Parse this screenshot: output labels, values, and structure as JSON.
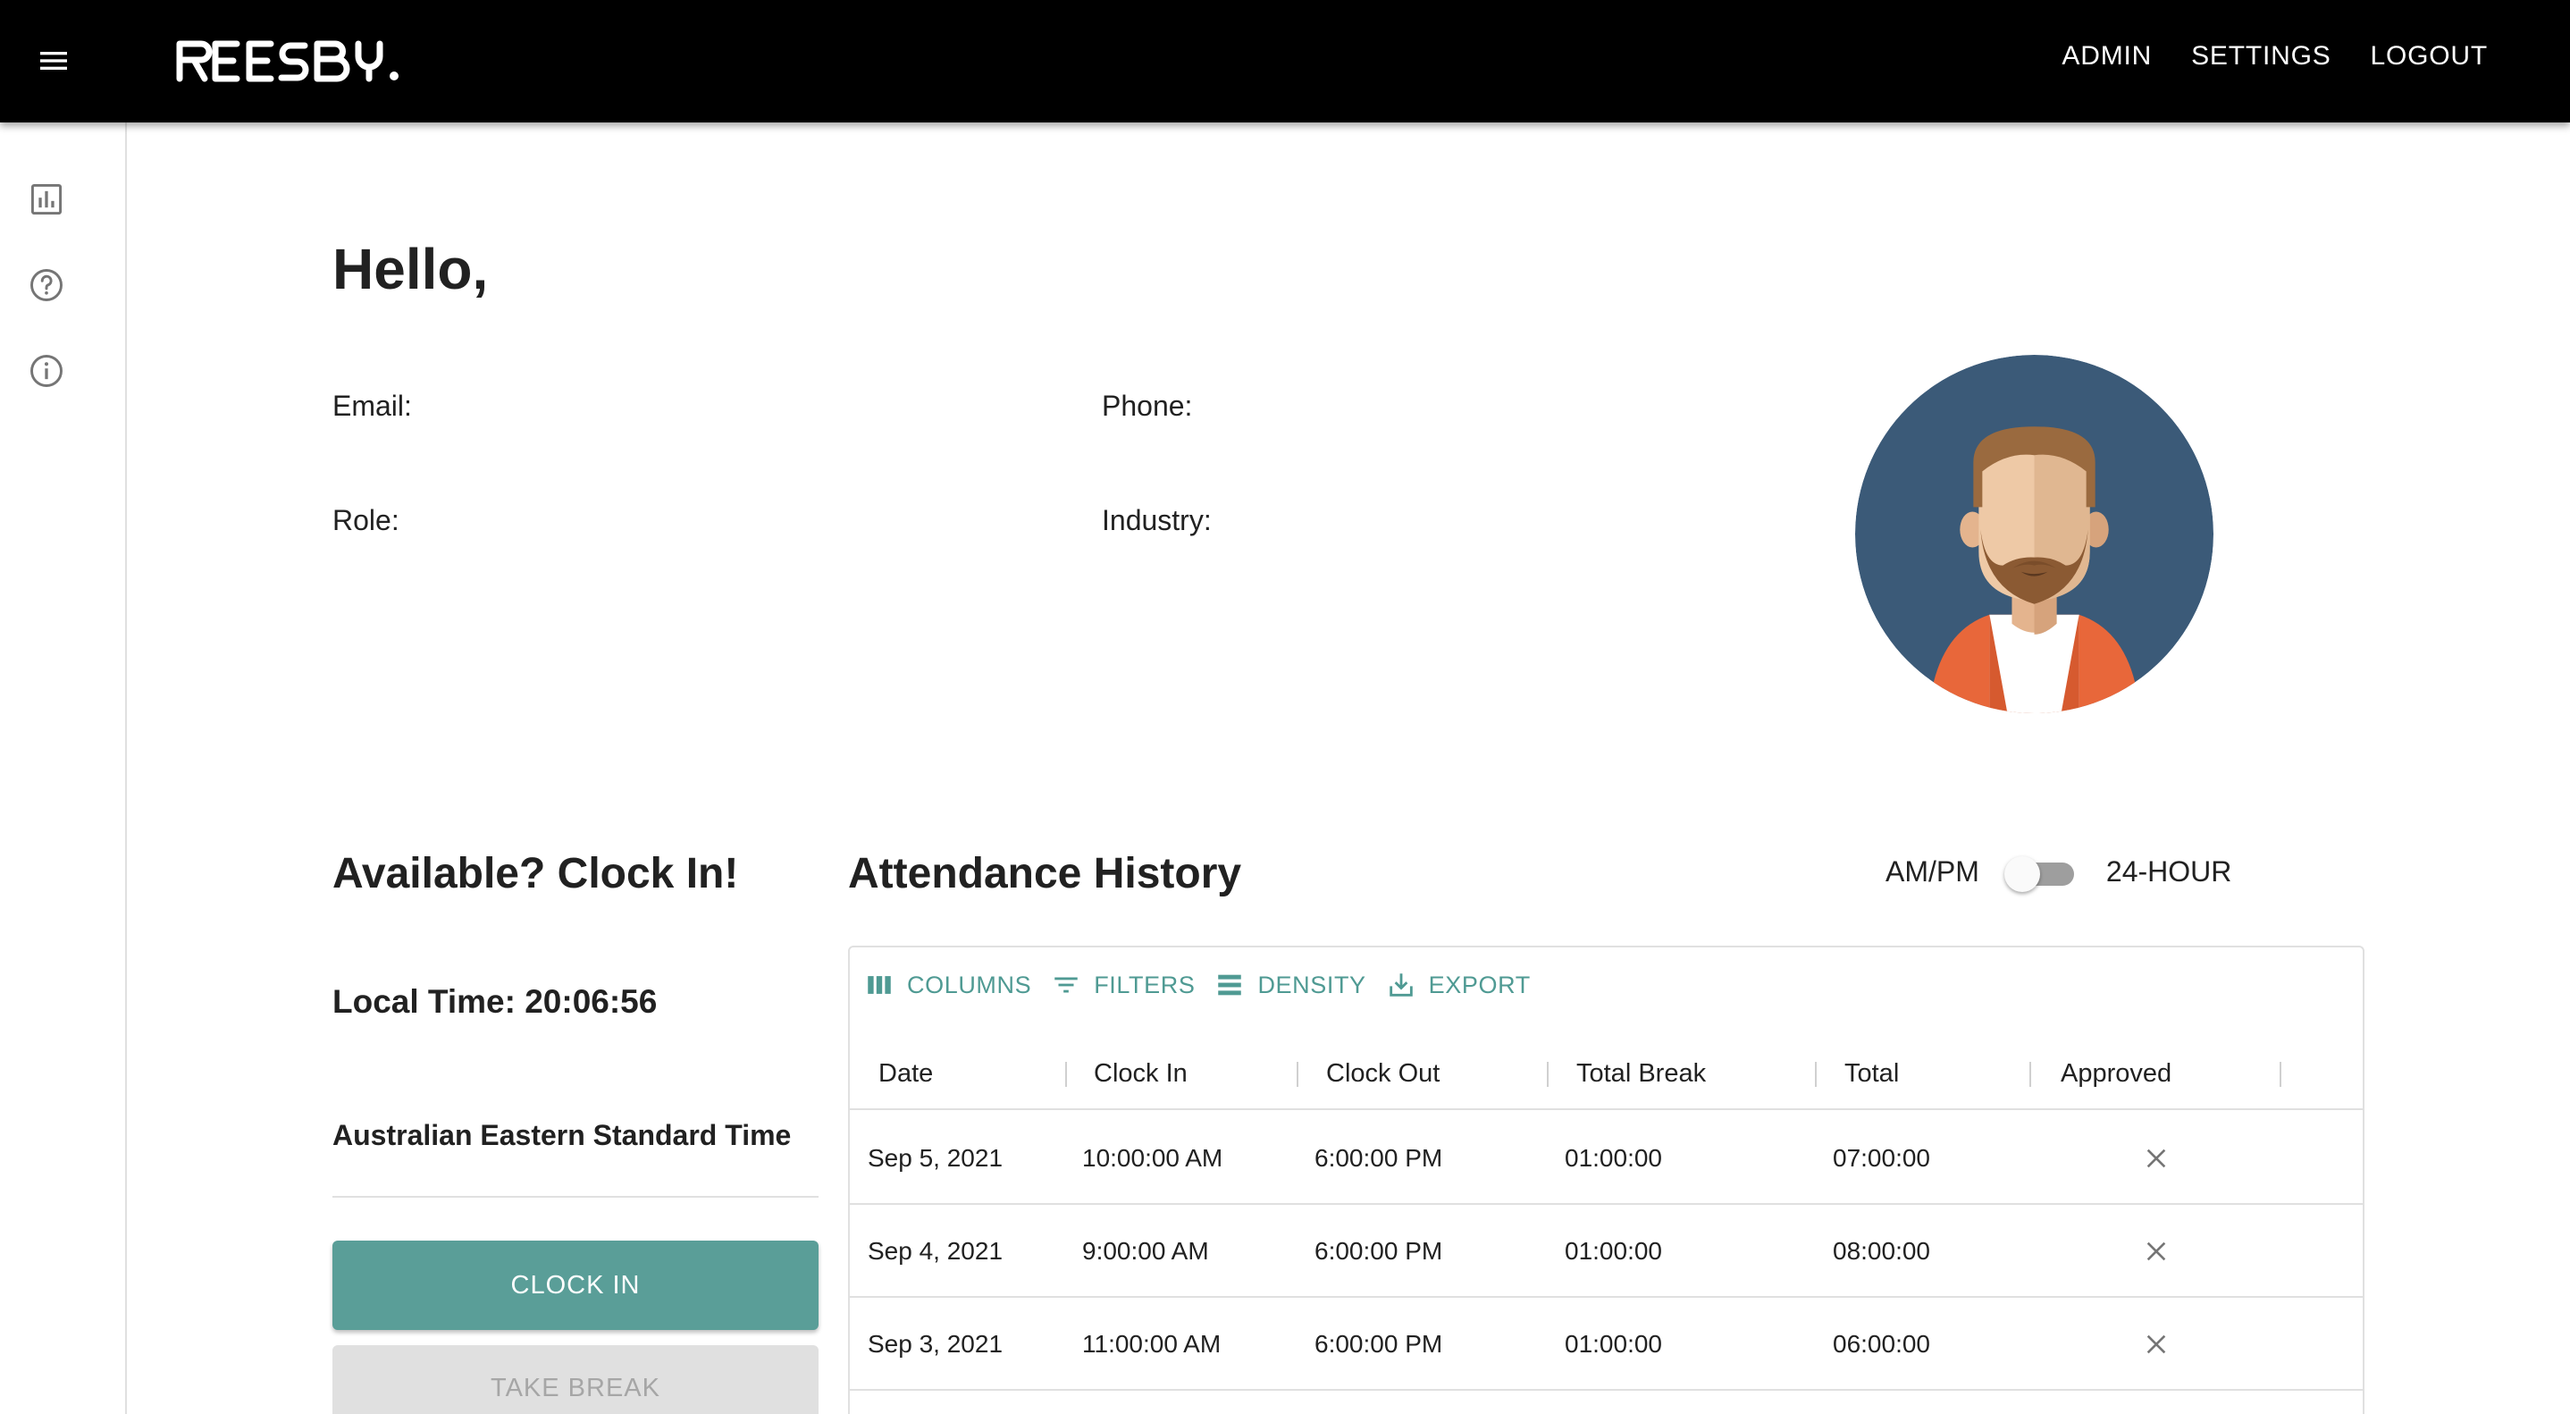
{
  "appbar": {
    "logo_text": "REESBY.",
    "nav": [
      "ADMIN",
      "SETTINGS",
      "LOGOUT"
    ]
  },
  "rail": {
    "icons": [
      "bar-chart-icon",
      "help-circle-icon",
      "info-circle-icon"
    ]
  },
  "profile": {
    "greeting": "Hello,",
    "email_label": "Email:",
    "phone_label": "Phone:",
    "role_label": "Role:",
    "industry_label": "Industry:"
  },
  "clock": {
    "title": "Available? Clock In!",
    "local_time_label": "Local Time: ",
    "local_time": "20:06:56",
    "timezone": "Australian Eastern Standard Time",
    "clock_in_label": "CLOCK IN",
    "take_break_label": "TAKE BREAK"
  },
  "attendance": {
    "title": "Attendance History",
    "toggle_left": "AM/PM",
    "toggle_right": "24-HOUR",
    "toggle_on": false,
    "toolbar": [
      "COLUMNS",
      "FILTERS",
      "DENSITY",
      "EXPORT"
    ],
    "columns": [
      "Date",
      "Clock In",
      "Clock Out",
      "Total Break",
      "Total",
      "Approved"
    ],
    "rows": [
      {
        "date": "Sep 5, 2021",
        "clock_in": "10:00:00 AM",
        "clock_out": "6:00:00 PM",
        "total_break": "01:00:00",
        "total": "07:00:00",
        "approved": false
      },
      {
        "date": "Sep 4, 2021",
        "clock_in": "9:00:00 AM",
        "clock_out": "6:00:00 PM",
        "total_break": "01:00:00",
        "total": "08:00:00",
        "approved": false
      },
      {
        "date": "Sep 3, 2021",
        "clock_in": "11:00:00 AM",
        "clock_out": "6:00:00 PM",
        "total_break": "01:00:00",
        "total": "06:00:00",
        "approved": false
      }
    ]
  },
  "colors": {
    "appbar": "#000000",
    "accent": "#5a9e98",
    "toolbar_text": "#4f9a93",
    "avatar_bg": "#3b5a78",
    "jacket": "#e8673a"
  }
}
